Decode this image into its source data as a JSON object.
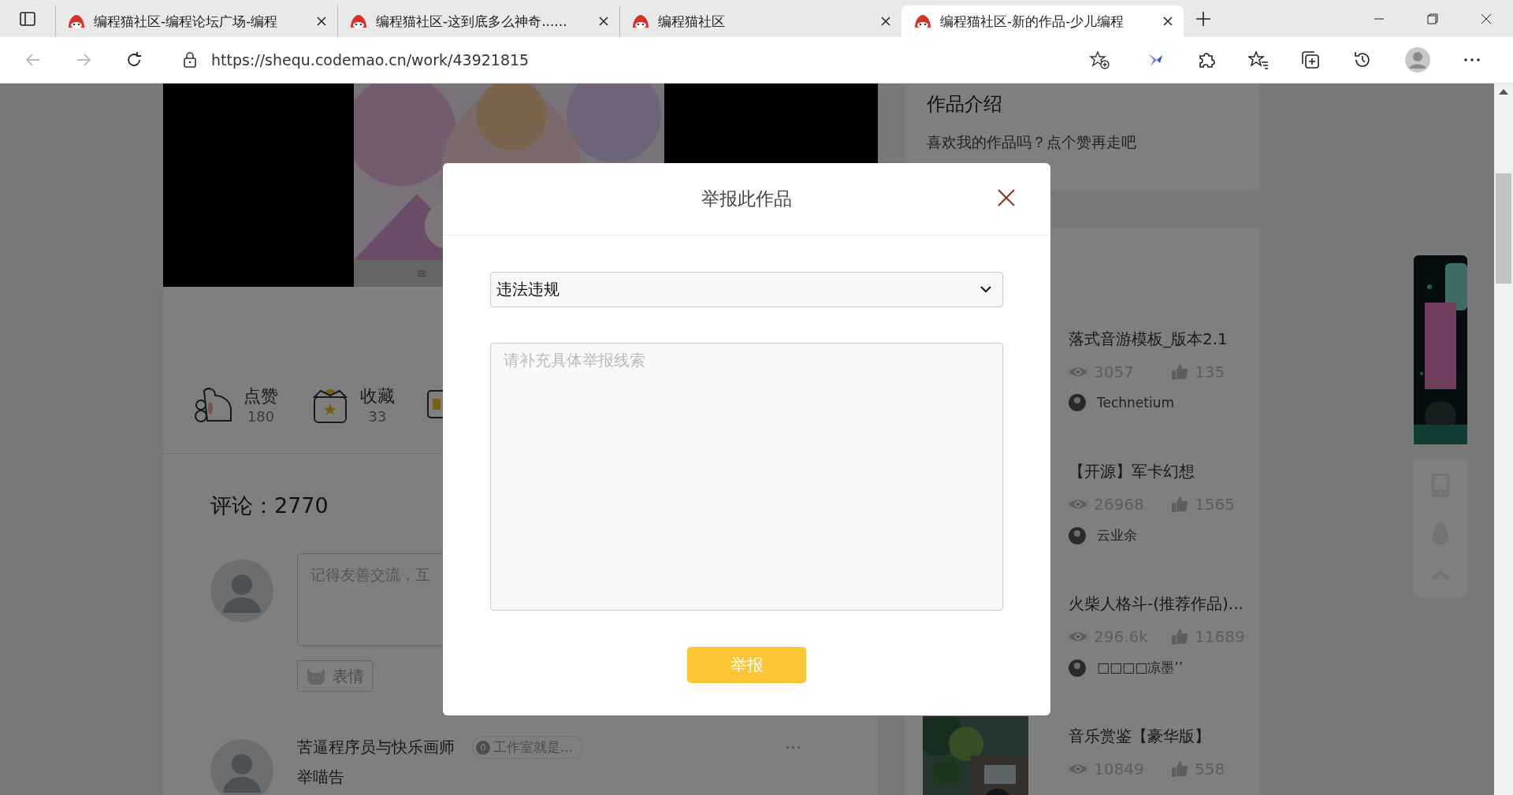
{
  "browser": {
    "tabs": [
      {
        "title": "编程猫社区-编程论坛广场-编程",
        "selected": false
      },
      {
        "title": "编程猫社区-这到底多么神奇......",
        "selected": false
      },
      {
        "title": "编程猫社区",
        "selected": false
      },
      {
        "title": "编程猫社区-新的作品-少儿编程",
        "selected": true
      }
    ],
    "address": "https://shequ.codemao.cn/work/43921815"
  },
  "work": {
    "actions": [
      {
        "kind": "like",
        "label": "点赞",
        "count": "180"
      },
      {
        "kind": "collect",
        "label": "收藏",
        "count": "33"
      }
    ],
    "comments_title": "评论：2770",
    "comment_box": {
      "placeholder": "记得友善交流，互"
    },
    "emoji_button": "表情",
    "comments": [
      {
        "author": "苦逼程序员与快乐画师",
        "badge_count": "0",
        "badge": "工作室就是...",
        "text": "举喵告",
        "more": "···"
      }
    ]
  },
  "intro": {
    "title": "作品介绍",
    "text": "喜欢我的作品吗？点个赞再走吧"
  },
  "related": [
    {
      "title": "落式音游模板_版本2.1",
      "views": "3057",
      "likes": "135",
      "author": "Technetium"
    },
    {
      "title": "【开源】军卡幻想",
      "views": "26968",
      "likes": "1565",
      "author": "云业余"
    },
    {
      "title": "火柴人格斗-(推荐作品)...",
      "views": "296.6k",
      "likes": "11689",
      "author": "□□□□凉墨’’"
    },
    {
      "title": "音乐赏鉴【豪华版】",
      "views": "10849",
      "likes": "558"
    }
  ],
  "modal": {
    "title": "举报此作品",
    "reason": "违法违规",
    "placeholder": "请补充具体举报线索",
    "submit": "举报"
  }
}
